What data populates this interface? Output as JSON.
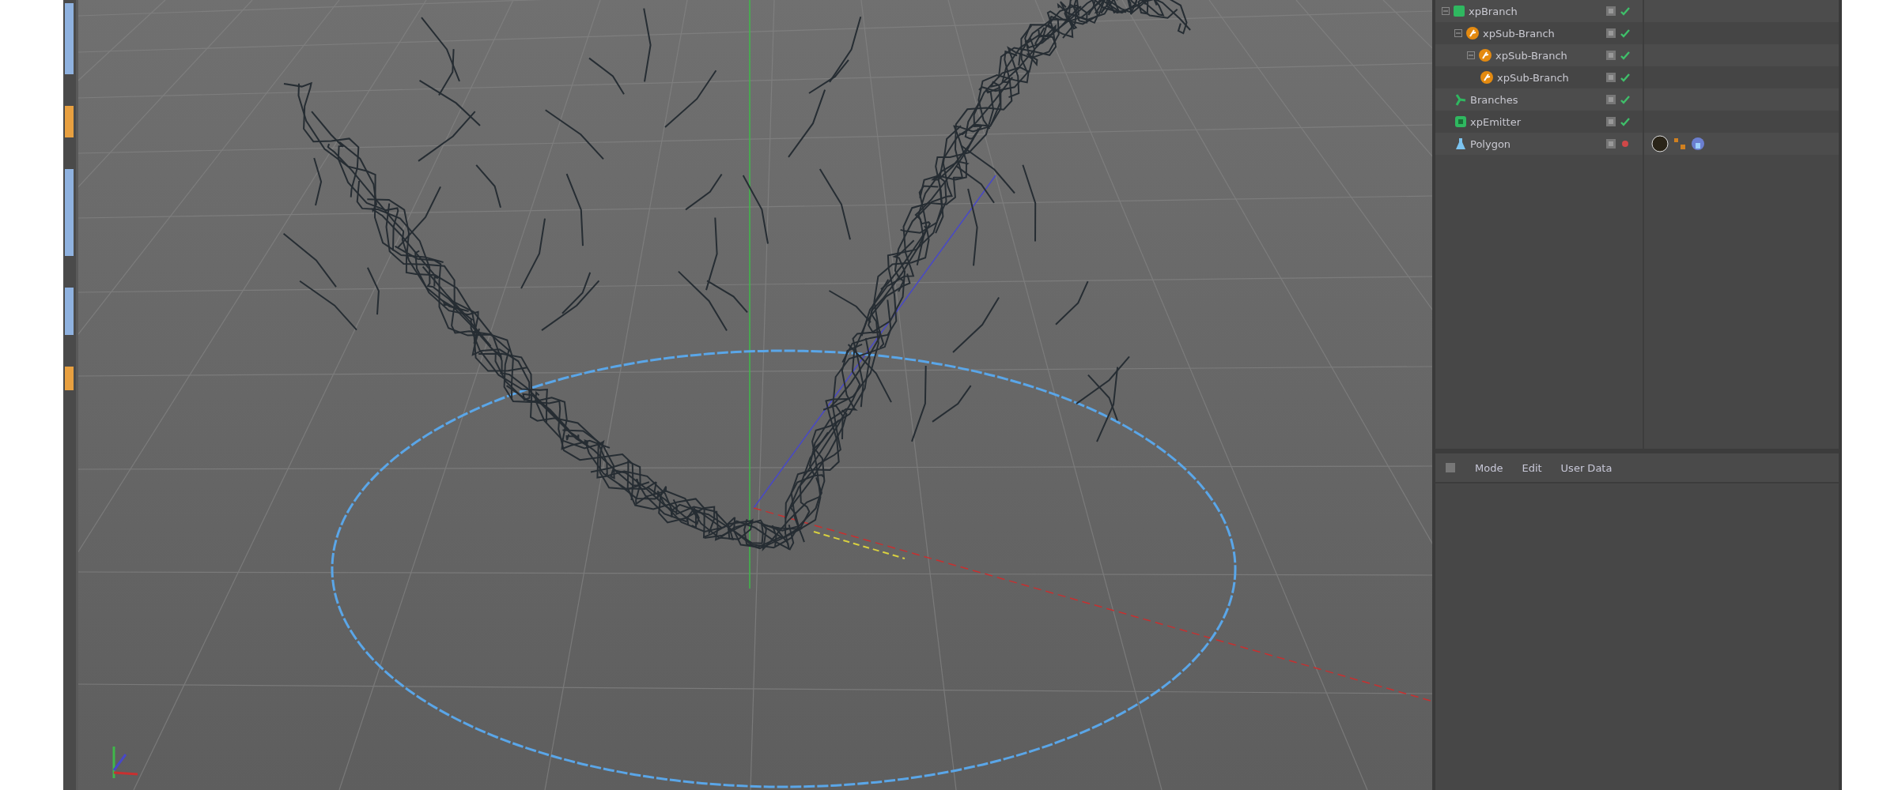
{
  "object_manager": {
    "objects": [
      {
        "name": "xpBranch",
        "kind": "branch",
        "enabled": true,
        "expanded": true,
        "children": [
          {
            "name": "xpSub-Branch",
            "kind": "sub-branch",
            "enabled": true,
            "expanded": true,
            "children": [
              {
                "name": "xpSub-Branch",
                "kind": "sub-branch",
                "enabled": true,
                "expanded": true,
                "children": [
                  {
                    "name": "xpSub-Branch",
                    "kind": "sub-branch",
                    "enabled": true
                  }
                ]
              }
            ]
          },
          {
            "name": "Branches",
            "kind": "branches",
            "enabled": true
          },
          {
            "name": "xpEmitter",
            "kind": "emitter",
            "enabled": true
          },
          {
            "name": "Polygon",
            "kind": "polygon",
            "enabled": false,
            "has_tags": true
          }
        ]
      }
    ]
  },
  "attributes": {
    "menu": [
      "Mode",
      "Edit",
      "User Data"
    ]
  }
}
